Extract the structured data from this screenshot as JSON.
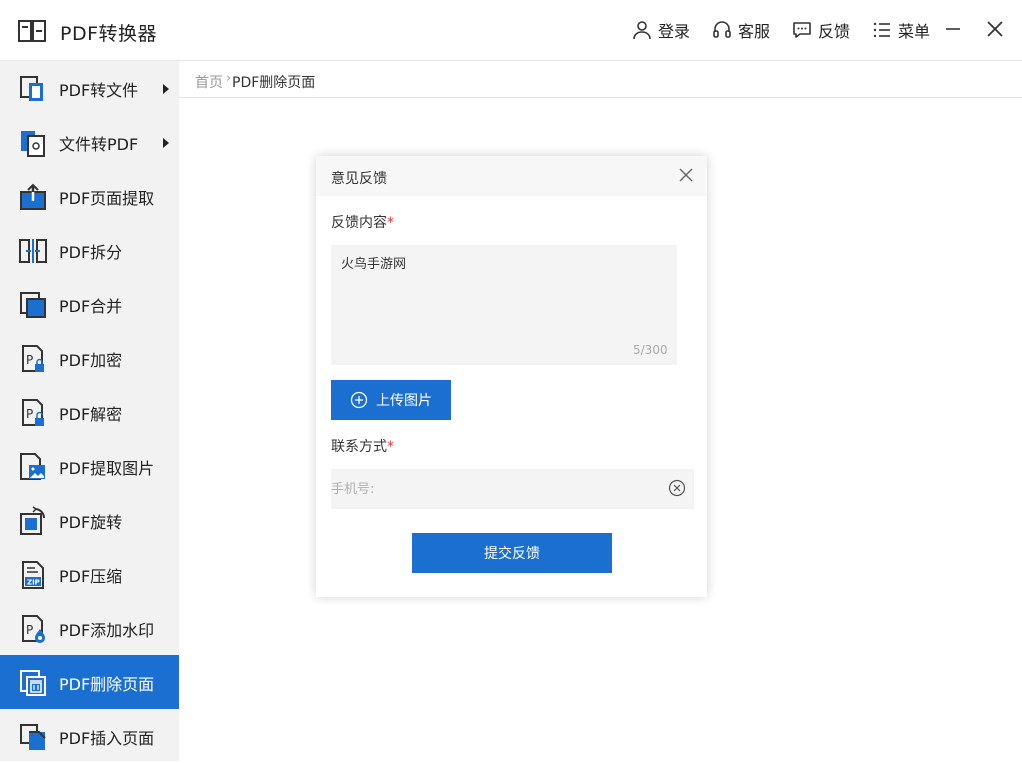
{
  "app": {
    "title": "PDF转换器",
    "actions": [
      {
        "label": "登录",
        "icon": "user-icon"
      },
      {
        "label": "客服",
        "icon": "headset-icon"
      },
      {
        "label": "反馈",
        "icon": "chat-icon"
      },
      {
        "label": "菜单",
        "icon": "menu-list-icon"
      }
    ]
  },
  "sidebar": {
    "items": [
      {
        "label": "PDF转文件",
        "icon": "pdf-to-file-icon",
        "has_submenu": true
      },
      {
        "label": "文件转PDF",
        "icon": "file-to-pdf-icon",
        "has_submenu": true
      },
      {
        "label": "PDF页面提取",
        "icon": "page-extract-icon"
      },
      {
        "label": "PDF拆分",
        "icon": "split-icon"
      },
      {
        "label": "PDF合并",
        "icon": "merge-icon"
      },
      {
        "label": "PDF加密",
        "icon": "encrypt-icon"
      },
      {
        "label": "PDF解密",
        "icon": "decrypt-icon"
      },
      {
        "label": "PDF提取图片",
        "icon": "extract-image-icon"
      },
      {
        "label": "PDF旋转",
        "icon": "rotate-icon"
      },
      {
        "label": "PDF压缩",
        "icon": "compress-zip-icon"
      },
      {
        "label": "PDF添加水印",
        "icon": "watermark-icon"
      },
      {
        "label": "PDF删除页面",
        "icon": "delete-page-icon",
        "active": true
      },
      {
        "label": "PDF插入页面",
        "icon": "insert-page-icon"
      }
    ]
  },
  "breadcrumb": {
    "home": "首页",
    "separator": "›",
    "current": "PDF删除页面"
  },
  "dialog": {
    "title": "意见反馈",
    "content_label": "反馈内容",
    "content_value": "火鸟手游网",
    "char_count": "5/300",
    "upload_label": "上传图片",
    "contact_label": "联系方式",
    "phone_placeholder": "手机号:",
    "required_mark": "*",
    "submit_label": "提交反馈"
  },
  "colors": {
    "accent": "#1a6fd0",
    "sidebar_bg": "#f2f2f2",
    "required": "#e53935"
  }
}
